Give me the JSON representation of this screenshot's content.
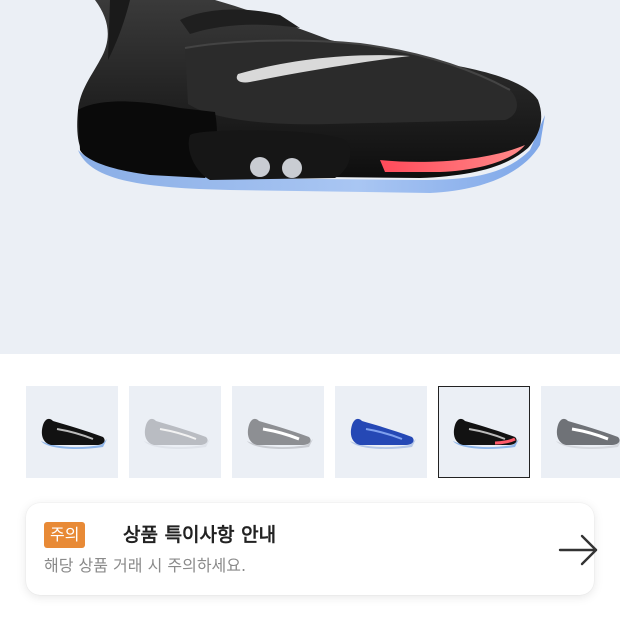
{
  "product": {
    "main_image": "nike-adapt-bb-black-main",
    "hero_background": "#ebeff5"
  },
  "thumbnails": [
    {
      "name": "black-blue",
      "selected": false
    },
    {
      "name": "grey-light",
      "selected": false
    },
    {
      "name": "grey-white",
      "selected": false
    },
    {
      "name": "royal-blue",
      "selected": false
    },
    {
      "name": "black-red",
      "selected": true
    },
    {
      "name": "grey-dark",
      "selected": false
    }
  ],
  "notice": {
    "badge": "주의",
    "title": "상품 특이사항 안내",
    "subtitle": "해당 상품 거래 시 주의하세요.",
    "arrow_icon": "arrow-right-icon",
    "badge_color": "#e88a36"
  }
}
